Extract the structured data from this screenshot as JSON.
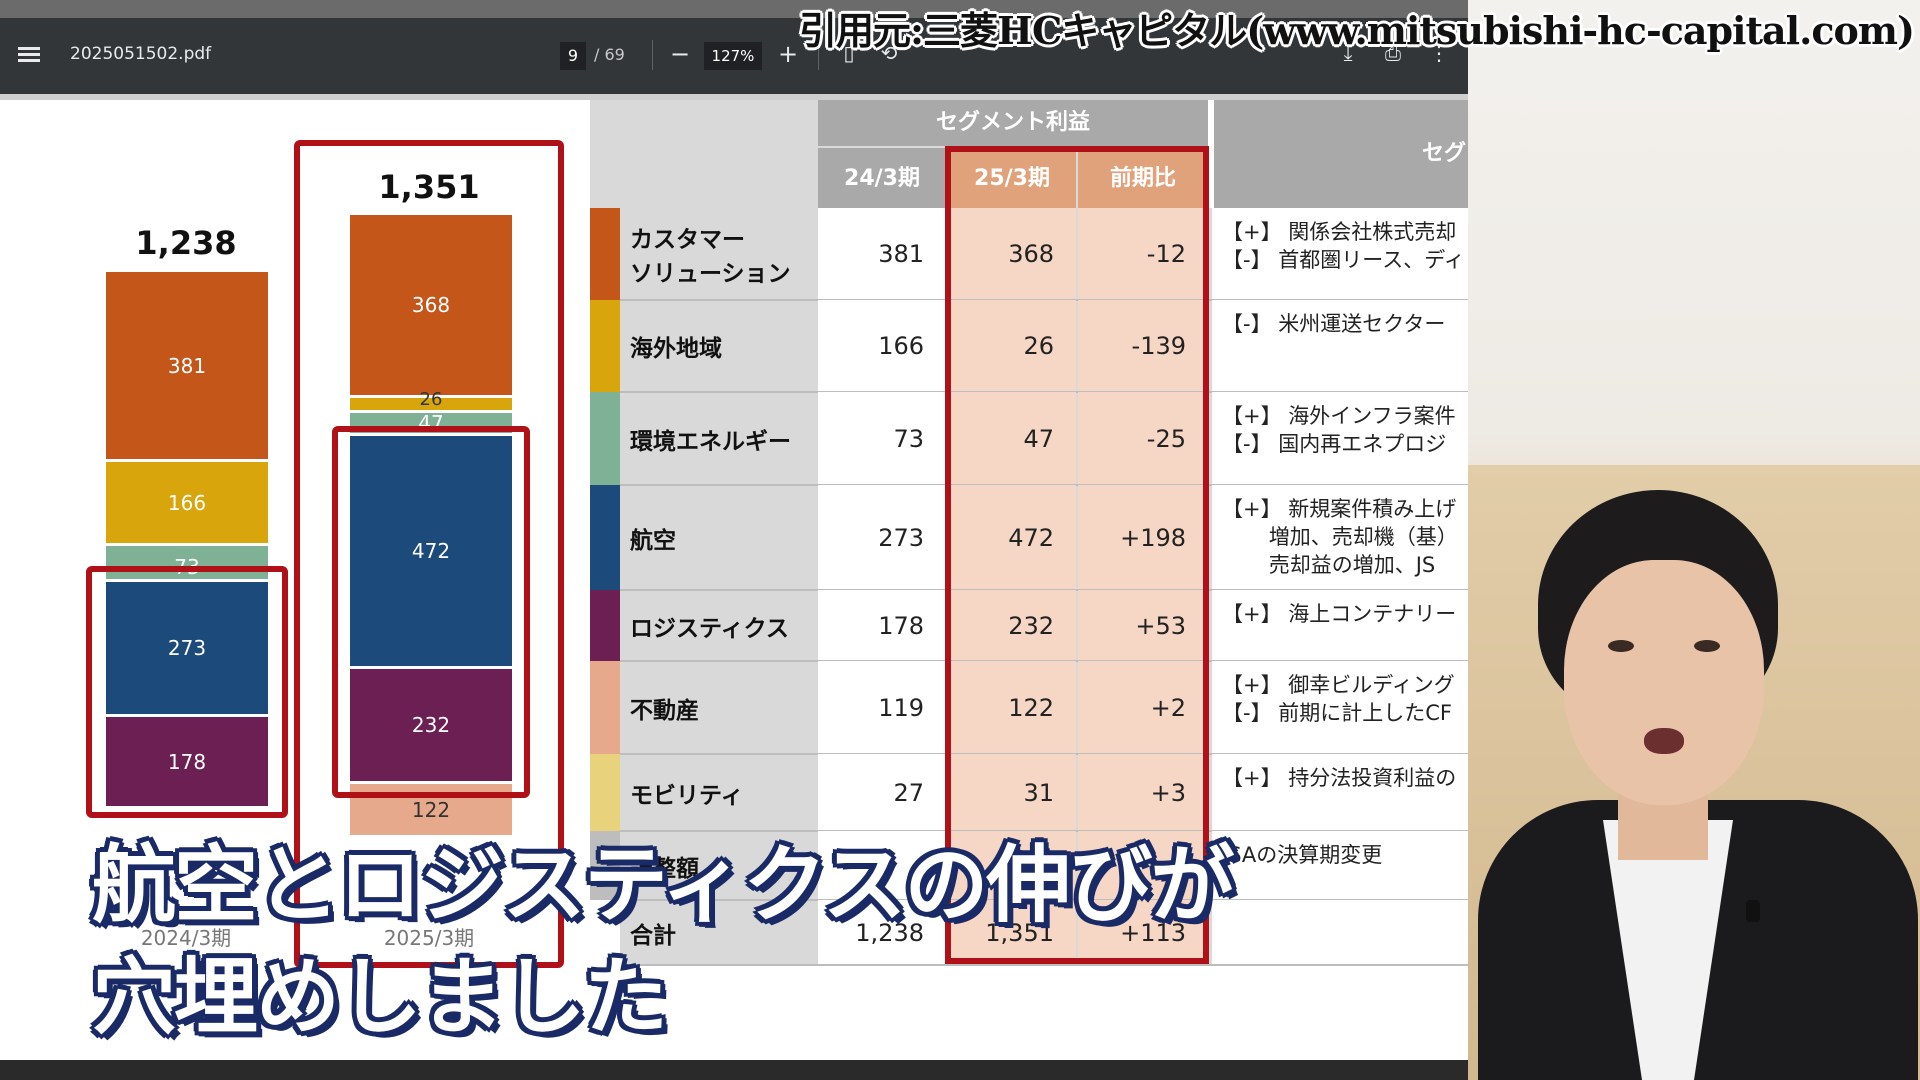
{
  "source_credit": "引用元:三菱HCキャピタル(www.mitsubishi-hc-capital.com)",
  "viewer": {
    "file_name": "2025051502.pdf",
    "page_current": "9",
    "page_total": "/ 69",
    "zoom": "127%",
    "minus": "−",
    "plus": "+"
  },
  "chart_data": {
    "type": "bar",
    "stacked": true,
    "categories": [
      "2024/3期",
      "2025/3期"
    ],
    "totals": [
      "1,238",
      "1,351"
    ],
    "series": [
      {
        "name": "不動産",
        "values": [
          null,
          122
        ],
        "color": "#e7a98b"
      },
      {
        "name": "ロジスティクス",
        "values": [
          178,
          232
        ],
        "color": "#6b1f53"
      },
      {
        "name": "航空",
        "values": [
          273,
          472
        ],
        "color": "#1c4a7a"
      },
      {
        "name": "環境エネルギー",
        "values": [
          73,
          47
        ],
        "color": "#7fb196"
      },
      {
        "name": "海外地域",
        "values": [
          166,
          26
        ],
        "color": "#d8a50d"
      },
      {
        "name": "カスタマーソリューション",
        "values": [
          381,
          368
        ],
        "color": "#c4561a"
      }
    ],
    "segment_labels": {
      "col1": [
        "381",
        "166",
        "73",
        "273",
        "178"
      ],
      "col2": [
        "368",
        "26",
        "47",
        "472",
        "232",
        "122"
      ]
    }
  },
  "table": {
    "group_header": "セグメント利益",
    "group_header_cut": "セグ",
    "headers": [
      "24/3期",
      "25/3期",
      "前期比"
    ],
    "rows": [
      {
        "label": "カスタマー\nソリューション",
        "color": "#c4561a",
        "v1": "381",
        "v2": "368",
        "diff": "-12",
        "note": "【+】 関係会社株式売却\n【-】 首都圏リース、ディ"
      },
      {
        "label": "海外地域",
        "color": "#d8a50d",
        "v1": "166",
        "v2": "26",
        "diff": "-139",
        "note": "【-】 米州運送セクター"
      },
      {
        "label": "環境エネルギー",
        "color": "#7fb196",
        "v1": "73",
        "v2": "47",
        "diff": "-25",
        "note": "【+】 海外インフラ案件\n【-】 国内再エネプロジ"
      },
      {
        "label": "航空",
        "color": "#1c4a7a",
        "v1": "273",
        "v2": "472",
        "diff": "+198",
        "note": "【+】 新規案件積み上げ\n       増加、売却機（基）\n       売却益の増加、JS"
      },
      {
        "label": "ロジスティクス",
        "color": "#6b1f53",
        "v1": "178",
        "v2": "232",
        "diff": "+53",
        "note": "【+】 海上コンテナリー"
      },
      {
        "label": "不動産",
        "color": "#e7a98b",
        "v1": "119",
        "v2": "122",
        "diff": "+2",
        "note": "【+】 御幸ビルディング\n【-】 前期に計上したCF"
      },
      {
        "label": "モビリティ",
        "color": "#e8d27c",
        "v1": "27",
        "v2": "31",
        "diff": "+3",
        "note": "【+】 持分法投資利益の"
      },
      {
        "label": "調整額",
        "color": "#bdbdbd",
        "v1": "",
        "v2": "",
        "diff": "",
        "note": "JSAの決算期変更"
      },
      {
        "label": "合計",
        "color": "#ffffff",
        "v1": "1,238",
        "v2": "1,351",
        "diff": "+113",
        "note": ""
      }
    ]
  },
  "subtitles": {
    "line1": "航空とロジスティクスの伸びが",
    "line2": "穴埋めしました"
  }
}
